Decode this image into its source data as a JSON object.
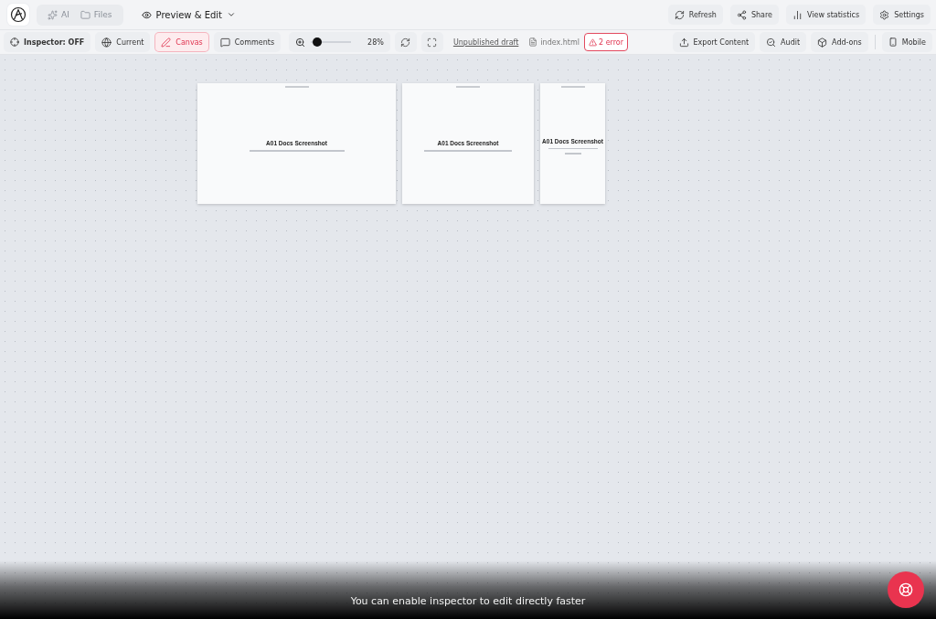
{
  "header": {
    "nav": [
      {
        "label": "AI",
        "selected": false
      },
      {
        "label": "Files",
        "selected": false
      }
    ],
    "mode": "Preview & Edit",
    "actions": [
      {
        "label": "Refresh"
      },
      {
        "label": "Share"
      },
      {
        "label": "View statistics"
      },
      {
        "label": "Settings"
      }
    ]
  },
  "toolbar": {
    "inspector": "Inspector: OFF",
    "views": [
      {
        "label": "Current",
        "selected": false
      },
      {
        "label": "Canvas",
        "selected": true
      },
      {
        "label": "Comments",
        "selected": false
      }
    ],
    "zoom": {
      "level": 0.05,
      "reading": "28%"
    },
    "draft_link": "Unpublished draft",
    "file": "index.html",
    "errors": "2 error",
    "actions": [
      {
        "label": "Export Content"
      },
      {
        "label": "Audit"
      },
      {
        "label": "Add-ons"
      }
    ],
    "device": "Mobile"
  },
  "frames": [
    {
      "kind": "desktop",
      "title": "A01 Docs Screenshot"
    },
    {
      "kind": "tablet",
      "title": "A01 Docs Screenshot"
    },
    {
      "kind": "mobile",
      "title": "A01 Docs Screenshot"
    }
  ],
  "toast": "You can enable inspector to edit directly faster"
}
